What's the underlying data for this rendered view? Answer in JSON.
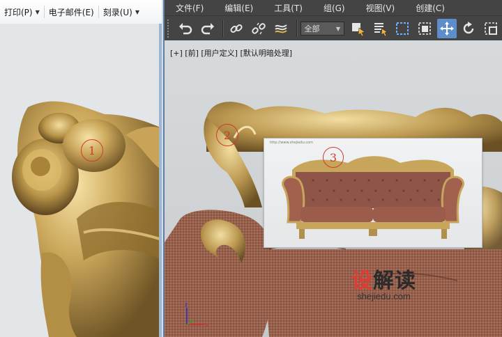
{
  "left_window": {
    "menu": [
      {
        "label": "打印(P)",
        "has_dropdown": true
      },
      {
        "label": "电子邮件(E)",
        "has_dropdown": false
      },
      {
        "label": "刻录(U)",
        "has_dropdown": true
      }
    ],
    "annotation_number": "1"
  },
  "max_window": {
    "menu": [
      "文件(F)",
      "编辑(E)",
      "工具(T)",
      "组(G)",
      "视图(V)",
      "创建(C)"
    ],
    "toolbar": {
      "selection_filter": "全部",
      "icons": [
        "undo-icon",
        "redo-icon",
        "link-icon",
        "unlink-icon",
        "bind-space-warp-icon",
        "select-object-icon",
        "select-by-name-icon",
        "rect-selection-region-icon",
        "window-crossing-icon",
        "select-and-move-icon",
        "select-and-rotate-icon",
        "select-and-scale-icon"
      ],
      "active_tool": "select-and-move-icon",
      "accent_color": "#5b8ecb"
    },
    "viewport": {
      "label": "[+] [前] [用户定义] [默认明暗处理]",
      "annotation_number_2": "2",
      "annotation_number_3": "3",
      "inset_url": "http://www.shejiedu.com"
    }
  },
  "watermark": {
    "cn_first": "设",
    "cn_rest": "解读",
    "en": "shejiedu.com",
    "brand_color": "#e23a33"
  }
}
